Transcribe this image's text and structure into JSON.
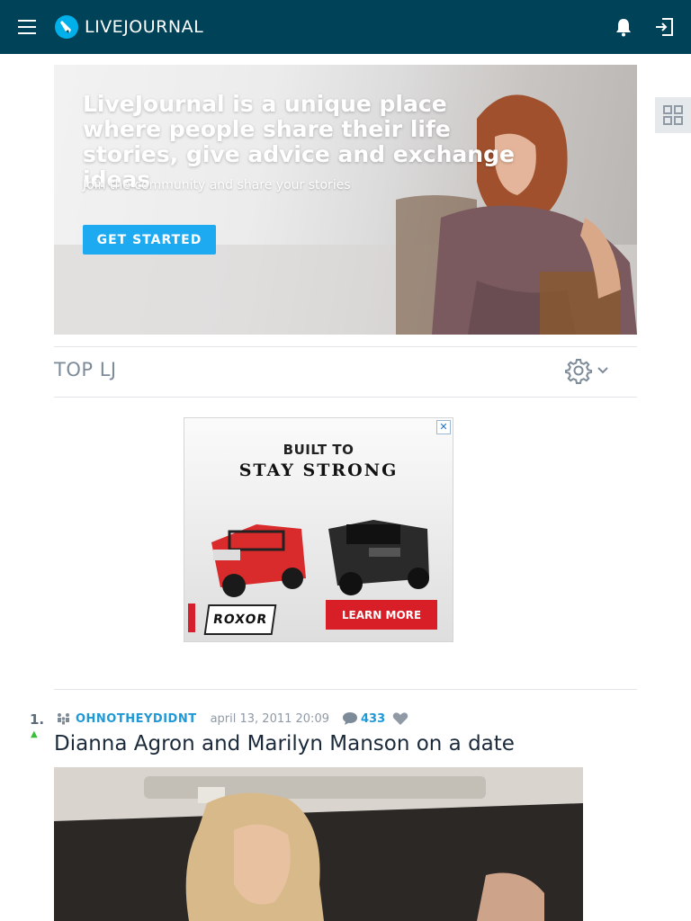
{
  "header": {
    "logo_text": "LIVEJOURNAL",
    "icons": [
      "menu-icon",
      "livejournal-logo-icon",
      "bell-icon",
      "login-icon"
    ],
    "brand_color": "#004359"
  },
  "sidebar_toggle": {
    "icon": "grid-icon"
  },
  "hero": {
    "title": "LiveJournal is a unique place where people share their life stories, give advice and exchange ideas",
    "subtitle": "Join the community and share your stories",
    "cta_label": "GET STARTED",
    "cta_color": "#1eaaf1"
  },
  "top_lj": {
    "title": "TOP LJ",
    "icons": [
      "gear-icon",
      "chevron-down-icon"
    ]
  },
  "ad": {
    "close_label": "✕",
    "line1": "BUILT TO",
    "line2": "STAY STRONG",
    "brand": "ROXOR",
    "cta_label": "LEARN MORE",
    "cta_color": "#d81f28"
  },
  "post": {
    "rank": "1.",
    "rank_trend": "▲",
    "username": "OHNOTHEYDIDNT",
    "date": "april 13, 2011 20:09",
    "comment_count": "433",
    "title": "Dianna Agron and Marilyn Manson on a date",
    "accent_color": "#1f99d6"
  }
}
